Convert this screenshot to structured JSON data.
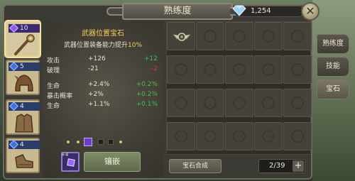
{
  "window": {
    "title": "熟练度"
  },
  "currency": {
    "icon": "diamond-icon",
    "value": "1,254"
  },
  "close": {
    "label": "✕"
  },
  "slots": [
    {
      "level": "10",
      "badge_color": "purple",
      "icon": "staff-icon",
      "selected": true
    },
    {
      "level": "5",
      "badge_color": "blue",
      "icon": "helmet-icon",
      "selected": false
    },
    {
      "level": "4",
      "badge_color": "blue",
      "icon": "armor-icon",
      "selected": false
    },
    {
      "level": "4",
      "badge_color": "blue",
      "icon": "boots-icon",
      "selected": false
    }
  ],
  "info": {
    "title": "武器位置宝石",
    "subtitle_prefix": "武器位置装备能力提升",
    "subtitle_value": "10%",
    "stats": [
      {
        "name": "攻击",
        "value": "+126",
        "delta": "+12",
        "delta_color": "green"
      },
      {
        "name": "破理",
        "value": "-21",
        "delta": "-2",
        "delta_color": "red"
      },
      {
        "name": "生命",
        "value": "+2.4%",
        "delta": "+0.2%",
        "delta_color": "green"
      },
      {
        "name": "暴击概率",
        "value": "+2%",
        "delta": "+0.2%",
        "delta_color": "green"
      },
      {
        "name": "生命",
        "value": "+1.1%",
        "delta": "+0.1%",
        "delta_color": "green"
      }
    ],
    "gem_slot_level": "+4",
    "inlay_button": "镶嵌"
  },
  "grid": {
    "first_item_icon": "winged-orb-icon",
    "rows": 4,
    "cols": 5
  },
  "combine_button": "宝石合成",
  "page": {
    "indicator": "2/39",
    "plus": "+"
  },
  "side_tabs": [
    {
      "label": "熟练度",
      "active": false
    },
    {
      "label": "技能",
      "active": false
    },
    {
      "label": "宝石",
      "active": true
    }
  ],
  "colors": {
    "highlight": "#f2cf5b",
    "positive": "#3ec24a",
    "negative": "#e0342c"
  }
}
